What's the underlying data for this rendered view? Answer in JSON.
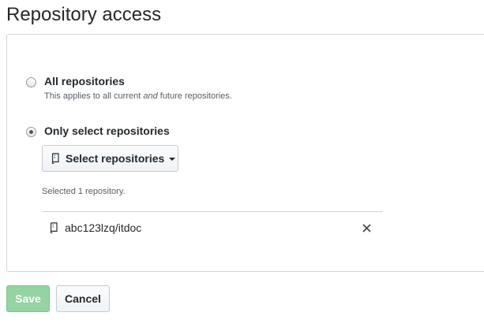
{
  "page": {
    "title": "Repository access"
  },
  "access": {
    "all": {
      "label": "All repositories",
      "note_before": "This applies to all current ",
      "note_em": "and",
      "note_after": " future repositories.",
      "checked": false
    },
    "select": {
      "label": "Only select repositories",
      "checked": true
    },
    "select_button_label": "Select repositories",
    "selected_count_text": "Selected 1 repository.",
    "repos": [
      {
        "name": "abc123lzq/itdoc",
        "icon": "repo-icon",
        "remove_icon": "close-icon"
      }
    ]
  },
  "actions": {
    "save_label": "Save",
    "cancel_label": "Cancel"
  },
  "colors": {
    "save_bg": "#94d3a2",
    "text": "#24292e",
    "muted": "#586069",
    "border": "#d1d5da"
  }
}
